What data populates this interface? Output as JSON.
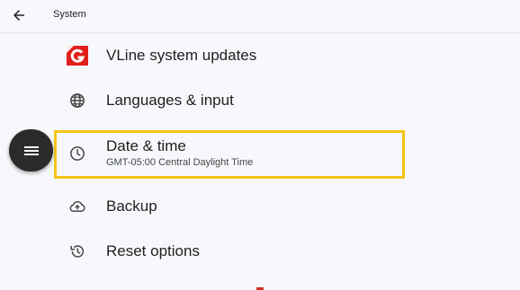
{
  "header": {
    "title": "System",
    "back_icon": "arrow-left-icon"
  },
  "items": [
    {
      "icon": "vline-logo-icon",
      "title": "VLine system updates"
    },
    {
      "icon": "globe-icon",
      "title": "Languages & input"
    },
    {
      "icon": "clock-icon",
      "title": "Date & time",
      "subtitle": "GMT-05:00 Central Daylight Time"
    },
    {
      "icon": "cloud-upload-icon",
      "title": "Backup"
    },
    {
      "icon": "history-icon",
      "title": "Reset options"
    }
  ],
  "fab": {
    "icon": "menu-icon"
  },
  "colors": {
    "background": "#f6f8fb",
    "highlight_border": "#f5c518",
    "fab_background": "#2b2b2b",
    "logo_red": "#e0201b"
  }
}
